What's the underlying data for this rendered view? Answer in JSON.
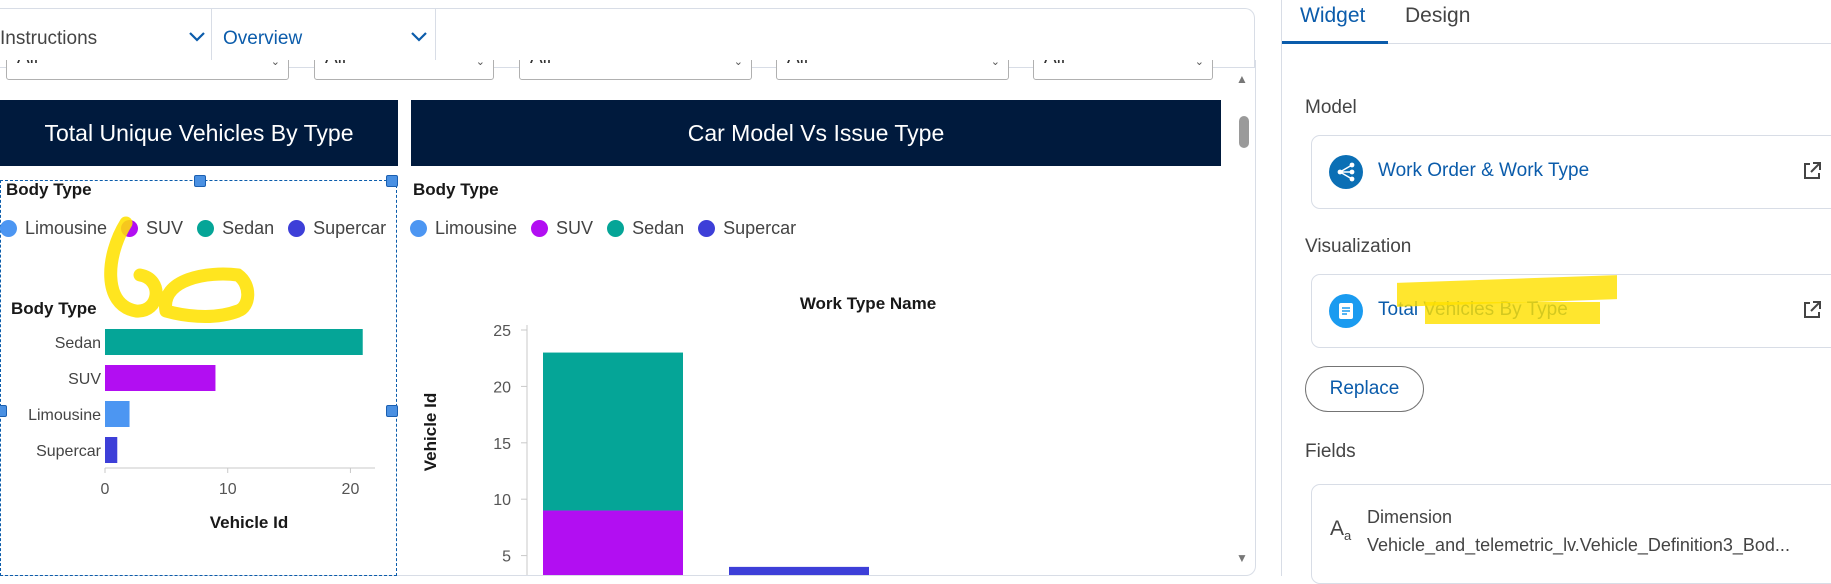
{
  "tabs": [
    {
      "label": "Instructions"
    },
    {
      "label": "Overview"
    }
  ],
  "filters": [
    {
      "value": "All"
    },
    {
      "value": "All"
    },
    {
      "value": "All"
    },
    {
      "value": "All"
    },
    {
      "value": "All"
    }
  ],
  "widgets": {
    "left": {
      "title": "Total Unique Vehicles By Type",
      "legend_title": "Body Type",
      "legend": [
        {
          "label": "Limousine",
          "color": "#4c96f2"
        },
        {
          "label": "SUV",
          "color": "#b20ef2"
        },
        {
          "label": "Sedan",
          "color": "#05a597"
        },
        {
          "label": "Supercar",
          "color": "#3d3fd8"
        }
      ]
    },
    "right": {
      "title": "Car Model Vs Issue Type",
      "legend_title": "Body Type",
      "legend": [
        {
          "label": "Limousine",
          "color": "#4c96f2"
        },
        {
          "label": "SUV",
          "color": "#b20ef2"
        },
        {
          "label": "Sedan",
          "color": "#05a597"
        },
        {
          "label": "Supercar",
          "color": "#3d3fd8"
        }
      ]
    }
  },
  "chart_data": [
    {
      "type": "bar",
      "orientation": "horizontal",
      "title": "",
      "categories_title": "Body Type",
      "categories": [
        "Sedan",
        "SUV",
        "Limousine",
        "Supercar"
      ],
      "values": [
        21,
        9,
        2,
        1
      ],
      "colors": [
        "#05a597",
        "#b20ef2",
        "#4c96f2",
        "#3d3fd8"
      ],
      "xlabel": "Vehicle Id",
      "xticks": [
        0,
        10,
        20
      ],
      "xlim": [
        0,
        22
      ]
    },
    {
      "type": "bar",
      "stacked": true,
      "title": "Work Type Name",
      "ylabel": "Vehicle Id",
      "yticks": [
        5,
        10,
        15,
        20,
        25
      ],
      "ylim": [
        0,
        25
      ],
      "series": [
        {
          "name": "SUV",
          "color": "#b20ef2",
          "values": [
            9,
            0
          ]
        },
        {
          "name": "Sedan",
          "color": "#05a597",
          "values": [
            14,
            0
          ]
        },
        {
          "name": "Supercar",
          "color": "#3d3fd8",
          "values": [
            0,
            4
          ]
        }
      ]
    }
  ],
  "right_panel": {
    "tabs": [
      {
        "label": "Widget"
      },
      {
        "label": "Design"
      }
    ],
    "model_label": "Model",
    "model_name": "Work Order & Work Type",
    "visualization_label": "Visualization",
    "visualization_name": "Total Vehicles By Type",
    "replace_label": "Replace",
    "fields_label": "Fields",
    "field_type": "Dimension",
    "field_name": "Vehicle_and_telemetric_lv.Vehicle_Definition3_Bod..."
  }
}
